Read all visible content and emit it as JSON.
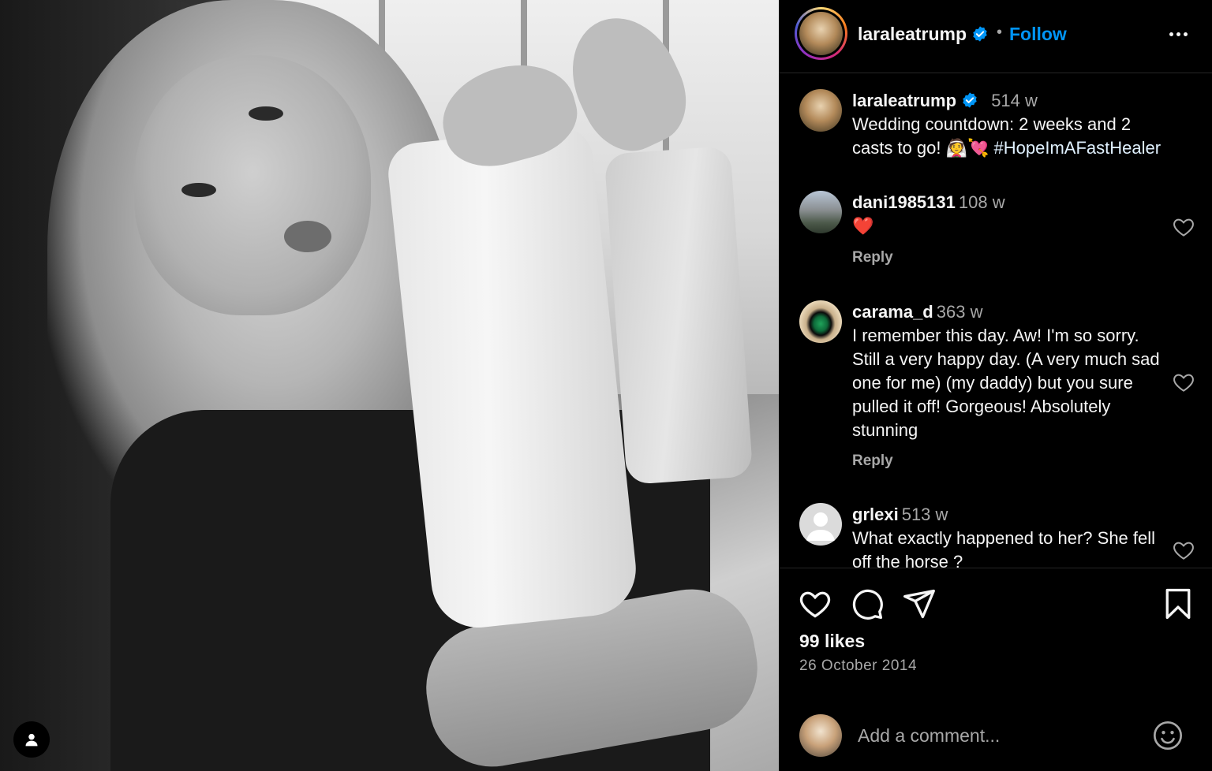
{
  "post": {
    "author": "laraleatrump",
    "follow_label": "Follow",
    "separator": "•",
    "likes": "99 likes",
    "date": "26 October 2014"
  },
  "caption": {
    "user": "laraleatrump",
    "time": "514 w",
    "text": "Wedding countdown: 2 weeks and 2 casts to go! 👰💘 ",
    "hashtag": "#HopeImAFastHealer"
  },
  "comments": [
    {
      "user": "dani1985131",
      "time": "108 w",
      "text": "❤️",
      "reply": "Reply"
    },
    {
      "user": "carama_d",
      "time": "363 w",
      "text": "I remember this day. Aw! I'm so sorry. Still a very happy day. (A very much sad one for me) (my daddy) but you sure pulled it off! Gorgeous! Absolutely stunning",
      "reply": "Reply"
    },
    {
      "user": "grlexi",
      "time": "513 w",
      "text": "What exactly happened to her? She fell off the horse ?"
    }
  ],
  "add_comment": {
    "placeholder": "Add a comment..."
  },
  "icons": {
    "verified": "verified-badge-icon",
    "more": "more-options-icon",
    "like": "heart-icon",
    "comment": "comment-icon",
    "share": "share-icon",
    "save": "bookmark-icon",
    "emoji": "emoji-icon",
    "user_tag": "user-tag-icon"
  },
  "colors": {
    "accent": "#0095f6",
    "verified": "#0095f6",
    "secondary_text": "#a8a8a8",
    "divider": "#262626"
  }
}
